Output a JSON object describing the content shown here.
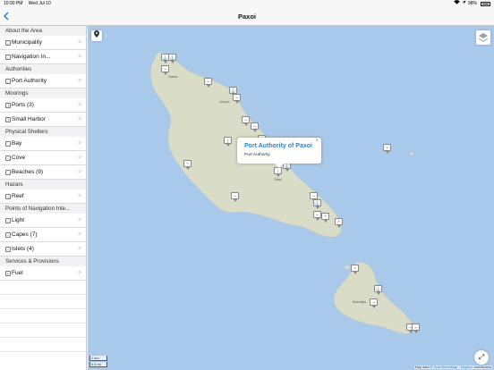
{
  "status": {
    "time": "10:00 PM",
    "date": "Wed Jul 10",
    "battery": "98%"
  },
  "nav": {
    "title": "Paxoi",
    "back_icon": "chevron-left-icon"
  },
  "sidebar": {
    "sections": [
      {
        "header": "About the Area",
        "items": [
          {
            "label": "Municipality"
          },
          {
            "label": "Navigation In..."
          }
        ]
      },
      {
        "header": "Authorities",
        "items": [
          {
            "label": "Port Authority"
          }
        ]
      },
      {
        "header": "Moorings",
        "items": [
          {
            "label": "Ports (3)"
          },
          {
            "label": "Small Harbor"
          }
        ]
      },
      {
        "header": "Physical Shelters",
        "items": [
          {
            "label": "Bay"
          },
          {
            "label": "Cove"
          },
          {
            "label": "Beaches (9)"
          }
        ]
      },
      {
        "header": "Hazars",
        "items": [
          {
            "label": "Reef"
          }
        ]
      },
      {
        "header": "Points of Navigation Inte...",
        "items": [
          {
            "label": "Light"
          },
          {
            "label": "Capes (7)"
          },
          {
            "label": "Islets (4)"
          }
        ]
      },
      {
        "header": "Services & Provisions",
        "items": [
          {
            "label": "Fuel"
          }
        ]
      }
    ]
  },
  "map": {
    "callout": {
      "title": "Port Authority of Paxoi",
      "subtitle": "Port Authority"
    },
    "scale": {
      "top": "1 km",
      "bottom": "0.5 mi"
    },
    "attribution": {
      "prefix": "Map data ©",
      "osm": "OpenStreetMap",
      "sep": "- ",
      "mapbox": "Mapbox",
      "suffix": "contributors"
    },
    "places": [
      "Λάκκα",
      "Λογγός",
      "Γάιος",
      "Άντίπαξοι"
    ],
    "colors": {
      "sea": "#a9c9ea",
      "land": "#d9dcc6",
      "accent": "#1a7ae0"
    }
  }
}
